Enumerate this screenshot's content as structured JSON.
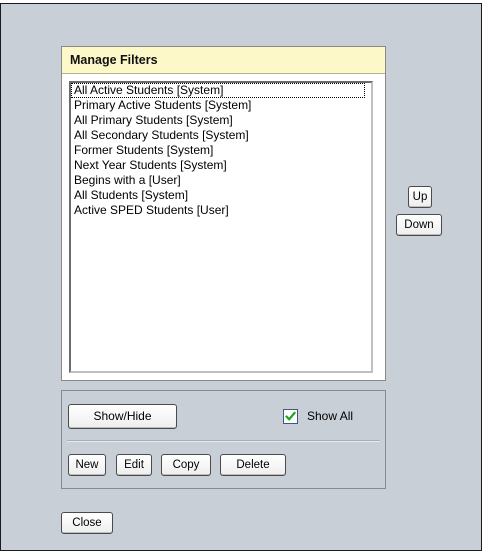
{
  "panel": {
    "title": "Manage Filters"
  },
  "filters": [
    "All Active Students [System]",
    "Primary Active Students [System]",
    "All Primary Students [System]",
    "All Secondary Students [System]",
    "Former Students [System]",
    "Next Year Students [System]",
    "Begins with a [User]",
    "All Students [System]",
    "Active SPED Students [User]"
  ],
  "reorder": {
    "up_label": "Up",
    "down_label": "Down"
  },
  "actions": {
    "showhide_label": "Show/Hide",
    "showall_label": "Show All",
    "showall_checked": true,
    "new_label": "New",
    "edit_label": "Edit",
    "copy_label": "Copy",
    "delete_label": "Delete"
  },
  "footer": {
    "close_label": "Close"
  },
  "colors": {
    "dialog_bg": "#c9cfd6",
    "header_bg": "#fdf8c8",
    "checkmark": "#1fa31f"
  }
}
